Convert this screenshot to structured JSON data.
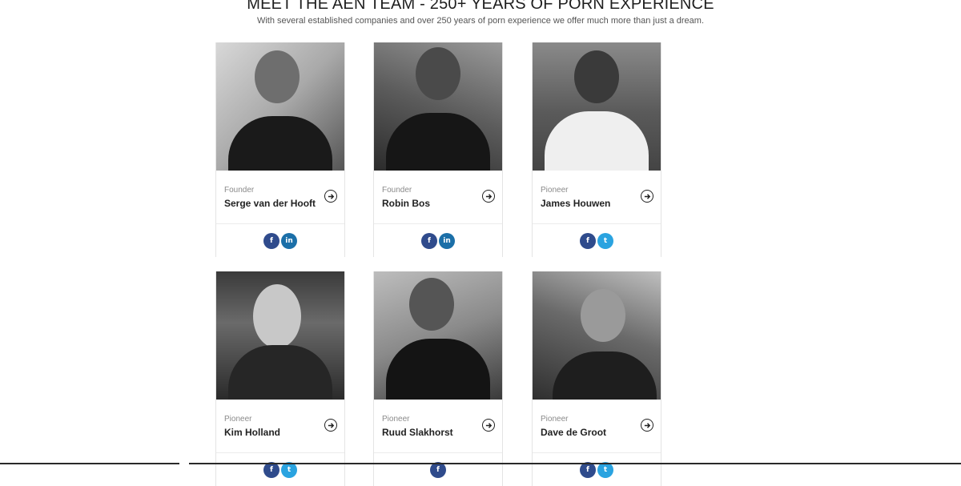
{
  "header": {
    "title": "MEET THE AEN TEAM - 250+ YEARS OF PORN EXPERIENCE",
    "subtitle": "With several established companies and over 250 years of porn experience we offer much more than just a dream."
  },
  "team": [
    {
      "role": "Founder",
      "name": "Serge van der Hooft",
      "socials": [
        "facebook",
        "linkedin"
      ]
    },
    {
      "role": "Founder",
      "name": "Robin Bos",
      "socials": [
        "facebook",
        "linkedin"
      ]
    },
    {
      "role": "Pioneer",
      "name": "James Houwen",
      "socials": [
        "facebook",
        "twitter"
      ]
    },
    {
      "role": "Pioneer",
      "name": "Kim Holland",
      "socials": [
        "facebook",
        "twitter"
      ]
    },
    {
      "role": "Pioneer",
      "name": "Ruud Slakhorst",
      "socials": [
        "facebook"
      ]
    },
    {
      "role": "Pioneer",
      "name": "Dave de Groot",
      "socials": [
        "facebook",
        "twitter"
      ]
    }
  ],
  "icons": {
    "facebook": "f",
    "linkedin": "in",
    "twitter": "t",
    "arrow": "arrow-right-circle-icon"
  },
  "colors": {
    "facebook": "#2f4b8c",
    "linkedin": "#1b6fa8",
    "twitter": "#2aa3e0"
  }
}
